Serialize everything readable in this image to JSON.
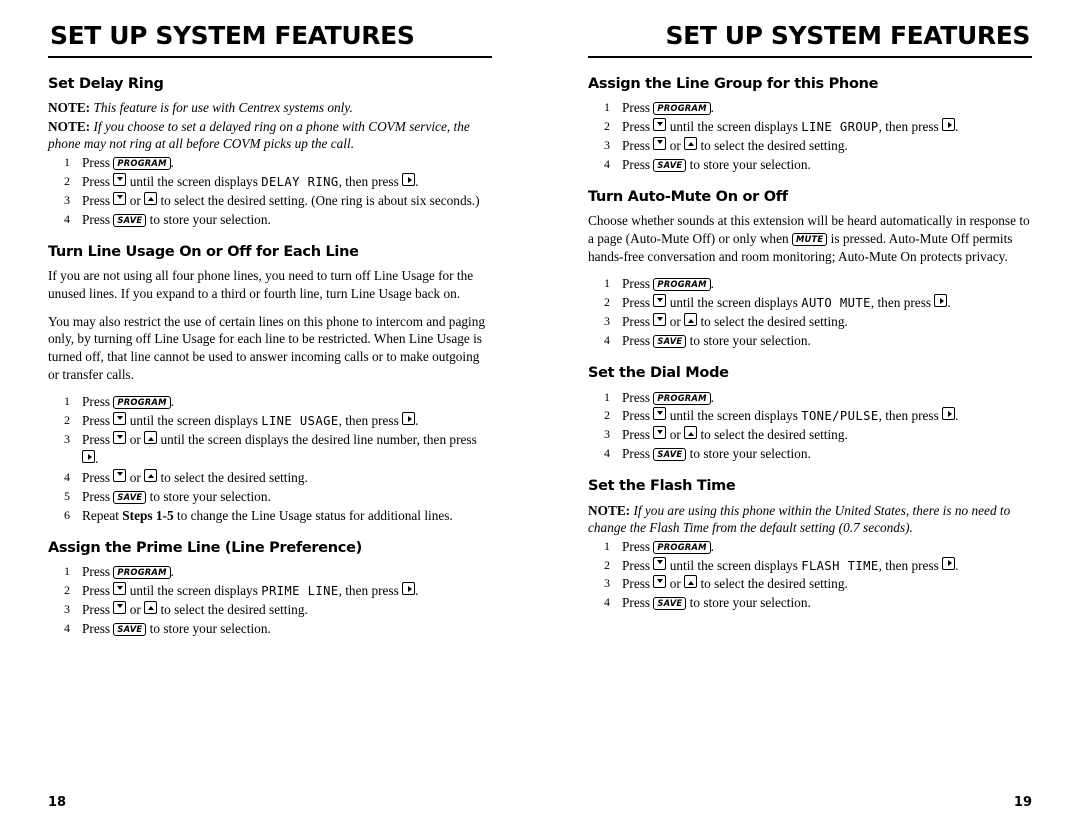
{
  "left_page": {
    "header": "SET UP SYSTEM FEATURES",
    "page_number": "18",
    "sections": [
      {
        "title": "Set Delay Ring",
        "notes": [
          {
            "label": "NOTE:",
            "text": "This feature is for use with Centrex systems only."
          },
          {
            "label": "NOTE:",
            "text": "If you choose to set a delayed ring on a phone with COVM service, the phone may not ring at all before COVM picks up the call."
          }
        ],
        "steps": [
          {
            "n": "1",
            "parts": [
              "Press ",
              {
                "btn": "PROGRAM"
              },
              "."
            ]
          },
          {
            "n": "2",
            "parts": [
              "Press ",
              {
                "key": "down"
              },
              " until the screen displays ",
              {
                "scr": "DELAY RING"
              },
              ", then press ",
              {
                "key": "right"
              },
              "."
            ]
          },
          {
            "n": "3",
            "parts": [
              "Press ",
              {
                "key": "down"
              },
              " or ",
              {
                "key": "up"
              },
              " to select the desired setting.  (One ring is about six seconds.)"
            ]
          },
          {
            "n": "4",
            "parts": [
              "Press ",
              {
                "btn": "SAVE"
              },
              " to store your selection."
            ]
          }
        ]
      },
      {
        "title": "Turn Line Usage On or Off for Each Line",
        "paragraphs": [
          "If you are not using all four phone lines, you need to turn off Line Usage for the unused lines.  If you expand to a third or fourth line, turn Line Usage back on.",
          "You may also restrict the use of certain lines on this phone to intercom and paging only, by turning off Line Usage for each line to be restricted.  When Line Usage is turned off, that line cannot be used to answer incoming calls or to make outgoing or transfer calls."
        ],
        "steps": [
          {
            "n": "1",
            "parts": [
              "Press ",
              {
                "btn": "PROGRAM"
              },
              "."
            ]
          },
          {
            "n": "2",
            "parts": [
              "Press ",
              {
                "key": "down"
              },
              " until the screen displays ",
              {
                "scr": "LINE USAGE"
              },
              ", then press ",
              {
                "key": "right"
              },
              "."
            ]
          },
          {
            "n": "3",
            "parts": [
              "Press ",
              {
                "key": "down"
              },
              " or ",
              {
                "key": "up"
              },
              " until the screen displays the desired line number, then press ",
              {
                "key": "right"
              },
              "."
            ]
          },
          {
            "n": "4",
            "parts": [
              "Press ",
              {
                "key": "down"
              },
              " or ",
              {
                "key": "up"
              },
              " to select the desired setting."
            ]
          },
          {
            "n": "5",
            "parts": [
              "Press ",
              {
                "btn": "SAVE"
              },
              " to store your selection."
            ]
          },
          {
            "n": "6",
            "parts": [
              "Repeat ",
              {
                "bold": "Steps 1-5"
              },
              " to change the Line Usage status for additional lines."
            ]
          }
        ]
      },
      {
        "title": "Assign the Prime Line (Line Preference)",
        "steps": [
          {
            "n": "1",
            "parts": [
              "Press ",
              {
                "btn": "PROGRAM"
              },
              "."
            ]
          },
          {
            "n": "2",
            "parts": [
              "Press ",
              {
                "key": "down"
              },
              " until the screen displays ",
              {
                "scr": "PRIME LINE"
              },
              ", then press ",
              {
                "key": "right"
              },
              "."
            ]
          },
          {
            "n": "3",
            "parts": [
              "Press ",
              {
                "key": "down"
              },
              " or ",
              {
                "key": "up"
              },
              " to select the desired setting."
            ]
          },
          {
            "n": "4",
            "parts": [
              "Press ",
              {
                "btn": "SAVE"
              },
              " to store your selection."
            ]
          }
        ]
      }
    ]
  },
  "right_page": {
    "header": "SET UP SYSTEM FEATURES",
    "page_number": "19",
    "sections": [
      {
        "title": "Assign the Line Group for this Phone",
        "steps": [
          {
            "n": "1",
            "parts": [
              "Press ",
              {
                "btn": "PROGRAM"
              },
              "."
            ]
          },
          {
            "n": "2",
            "parts": [
              "Press ",
              {
                "key": "down"
              },
              " until the screen displays ",
              {
                "scr": "LINE GROUP"
              },
              ", then press ",
              {
                "key": "right"
              },
              "."
            ]
          },
          {
            "n": "3",
            "parts": [
              "Press ",
              {
                "key": "down"
              },
              " or ",
              {
                "key": "up"
              },
              " to select the desired setting."
            ]
          },
          {
            "n": "4",
            "parts": [
              "Press ",
              {
                "btn": "SAVE"
              },
              " to store your selection."
            ]
          }
        ]
      },
      {
        "title": "Turn Auto-Mute On or Off",
        "paragraphs_rich": [
          [
            "Choose whether sounds at this extension will be heard automatically in response to a page (Auto-Mute Off) or only when ",
            {
              "btn": "MUTE"
            },
            " is pressed.  Auto-Mute Off permits hands-free conversation and room monitoring; Auto-Mute On protects privacy."
          ]
        ],
        "steps": [
          {
            "n": "1",
            "parts": [
              "Press ",
              {
                "btn": "PROGRAM"
              },
              "."
            ]
          },
          {
            "n": "2",
            "parts": [
              "Press ",
              {
                "key": "down"
              },
              " until the screen displays ",
              {
                "scr": "AUTO MUTE"
              },
              ", then press ",
              {
                "key": "right"
              },
              "."
            ]
          },
          {
            "n": "3",
            "parts": [
              "Press ",
              {
                "key": "down"
              },
              " or ",
              {
                "key": "up"
              },
              " to select the desired setting."
            ]
          },
          {
            "n": "4",
            "parts": [
              "Press ",
              {
                "btn": "SAVE"
              },
              " to store your selection."
            ]
          }
        ]
      },
      {
        "title": "Set the Dial Mode",
        "steps": [
          {
            "n": "1",
            "parts": [
              "Press ",
              {
                "btn": "PROGRAM"
              },
              "."
            ]
          },
          {
            "n": "2",
            "parts": [
              "Press ",
              {
                "key": "down"
              },
              " until the screen displays ",
              {
                "scr": "TONE/PULSE"
              },
              ", then press ",
              {
                "key": "right"
              },
              "."
            ]
          },
          {
            "n": "3",
            "parts": [
              "Press ",
              {
                "key": "down"
              },
              " or ",
              {
                "key": "up"
              },
              " to select the desired setting."
            ]
          },
          {
            "n": "4",
            "parts": [
              "Press ",
              {
                "btn": "SAVE"
              },
              " to store your selection."
            ]
          }
        ]
      },
      {
        "title": "Set the Flash Time",
        "notes": [
          {
            "label": "NOTE:",
            "text": "If you are using this phone within the United States, there is no need to change the Flash Time from the default setting (0.7 seconds)."
          }
        ],
        "steps": [
          {
            "n": "1",
            "parts": [
              "Press ",
              {
                "btn": "PROGRAM"
              },
              "."
            ]
          },
          {
            "n": "2",
            "parts": [
              "Press ",
              {
                "key": "down"
              },
              " until the screen displays ",
              {
                "scr": "FLASH TIME"
              },
              ", then press ",
              {
                "key": "right"
              },
              "."
            ]
          },
          {
            "n": "3",
            "parts": [
              "Press ",
              {
                "key": "down"
              },
              " or ",
              {
                "key": "up"
              },
              " to select the desired setting."
            ]
          },
          {
            "n": "4",
            "parts": [
              "Press ",
              {
                "btn": "SAVE"
              },
              " to store your selection."
            ]
          }
        ]
      }
    ]
  }
}
